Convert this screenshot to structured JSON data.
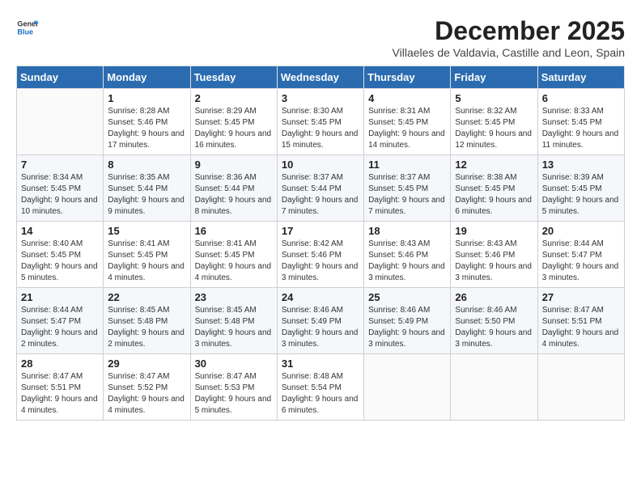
{
  "logo": {
    "general": "General",
    "blue": "Blue"
  },
  "title": "December 2025",
  "subtitle": "Villaeles de Valdavia, Castille and Leon, Spain",
  "header_days": [
    "Sunday",
    "Monday",
    "Tuesday",
    "Wednesday",
    "Thursday",
    "Friday",
    "Saturday"
  ],
  "weeks": [
    [
      {
        "day": "",
        "sunrise": "",
        "sunset": "",
        "daylight": ""
      },
      {
        "day": "1",
        "sunrise": "Sunrise: 8:28 AM",
        "sunset": "Sunset: 5:46 PM",
        "daylight": "Daylight: 9 hours and 17 minutes."
      },
      {
        "day": "2",
        "sunrise": "Sunrise: 8:29 AM",
        "sunset": "Sunset: 5:45 PM",
        "daylight": "Daylight: 9 hours and 16 minutes."
      },
      {
        "day": "3",
        "sunrise": "Sunrise: 8:30 AM",
        "sunset": "Sunset: 5:45 PM",
        "daylight": "Daylight: 9 hours and 15 minutes."
      },
      {
        "day": "4",
        "sunrise": "Sunrise: 8:31 AM",
        "sunset": "Sunset: 5:45 PM",
        "daylight": "Daylight: 9 hours and 14 minutes."
      },
      {
        "day": "5",
        "sunrise": "Sunrise: 8:32 AM",
        "sunset": "Sunset: 5:45 PM",
        "daylight": "Daylight: 9 hours and 12 minutes."
      },
      {
        "day": "6",
        "sunrise": "Sunrise: 8:33 AM",
        "sunset": "Sunset: 5:45 PM",
        "daylight": "Daylight: 9 hours and 11 minutes."
      }
    ],
    [
      {
        "day": "7",
        "sunrise": "Sunrise: 8:34 AM",
        "sunset": "Sunset: 5:45 PM",
        "daylight": "Daylight: 9 hours and 10 minutes."
      },
      {
        "day": "8",
        "sunrise": "Sunrise: 8:35 AM",
        "sunset": "Sunset: 5:44 PM",
        "daylight": "Daylight: 9 hours and 9 minutes."
      },
      {
        "day": "9",
        "sunrise": "Sunrise: 8:36 AM",
        "sunset": "Sunset: 5:44 PM",
        "daylight": "Daylight: 9 hours and 8 minutes."
      },
      {
        "day": "10",
        "sunrise": "Sunrise: 8:37 AM",
        "sunset": "Sunset: 5:44 PM",
        "daylight": "Daylight: 9 hours and 7 minutes."
      },
      {
        "day": "11",
        "sunrise": "Sunrise: 8:37 AM",
        "sunset": "Sunset: 5:45 PM",
        "daylight": "Daylight: 9 hours and 7 minutes."
      },
      {
        "day": "12",
        "sunrise": "Sunrise: 8:38 AM",
        "sunset": "Sunset: 5:45 PM",
        "daylight": "Daylight: 9 hours and 6 minutes."
      },
      {
        "day": "13",
        "sunrise": "Sunrise: 8:39 AM",
        "sunset": "Sunset: 5:45 PM",
        "daylight": "Daylight: 9 hours and 5 minutes."
      }
    ],
    [
      {
        "day": "14",
        "sunrise": "Sunrise: 8:40 AM",
        "sunset": "Sunset: 5:45 PM",
        "daylight": "Daylight: 9 hours and 5 minutes."
      },
      {
        "day": "15",
        "sunrise": "Sunrise: 8:41 AM",
        "sunset": "Sunset: 5:45 PM",
        "daylight": "Daylight: 9 hours and 4 minutes."
      },
      {
        "day": "16",
        "sunrise": "Sunrise: 8:41 AM",
        "sunset": "Sunset: 5:45 PM",
        "daylight": "Daylight: 9 hours and 4 minutes."
      },
      {
        "day": "17",
        "sunrise": "Sunrise: 8:42 AM",
        "sunset": "Sunset: 5:46 PM",
        "daylight": "Daylight: 9 hours and 3 minutes."
      },
      {
        "day": "18",
        "sunrise": "Sunrise: 8:43 AM",
        "sunset": "Sunset: 5:46 PM",
        "daylight": "Daylight: 9 hours and 3 minutes."
      },
      {
        "day": "19",
        "sunrise": "Sunrise: 8:43 AM",
        "sunset": "Sunset: 5:46 PM",
        "daylight": "Daylight: 9 hours and 3 minutes."
      },
      {
        "day": "20",
        "sunrise": "Sunrise: 8:44 AM",
        "sunset": "Sunset: 5:47 PM",
        "daylight": "Daylight: 9 hours and 3 minutes."
      }
    ],
    [
      {
        "day": "21",
        "sunrise": "Sunrise: 8:44 AM",
        "sunset": "Sunset: 5:47 PM",
        "daylight": "Daylight: 9 hours and 2 minutes."
      },
      {
        "day": "22",
        "sunrise": "Sunrise: 8:45 AM",
        "sunset": "Sunset: 5:48 PM",
        "daylight": "Daylight: 9 hours and 2 minutes."
      },
      {
        "day": "23",
        "sunrise": "Sunrise: 8:45 AM",
        "sunset": "Sunset: 5:48 PM",
        "daylight": "Daylight: 9 hours and 3 minutes."
      },
      {
        "day": "24",
        "sunrise": "Sunrise: 8:46 AM",
        "sunset": "Sunset: 5:49 PM",
        "daylight": "Daylight: 9 hours and 3 minutes."
      },
      {
        "day": "25",
        "sunrise": "Sunrise: 8:46 AM",
        "sunset": "Sunset: 5:49 PM",
        "daylight": "Daylight: 9 hours and 3 minutes."
      },
      {
        "day": "26",
        "sunrise": "Sunrise: 8:46 AM",
        "sunset": "Sunset: 5:50 PM",
        "daylight": "Daylight: 9 hours and 3 minutes."
      },
      {
        "day": "27",
        "sunrise": "Sunrise: 8:47 AM",
        "sunset": "Sunset: 5:51 PM",
        "daylight": "Daylight: 9 hours and 4 minutes."
      }
    ],
    [
      {
        "day": "28",
        "sunrise": "Sunrise: 8:47 AM",
        "sunset": "Sunset: 5:51 PM",
        "daylight": "Daylight: 9 hours and 4 minutes."
      },
      {
        "day": "29",
        "sunrise": "Sunrise: 8:47 AM",
        "sunset": "Sunset: 5:52 PM",
        "daylight": "Daylight: 9 hours and 4 minutes."
      },
      {
        "day": "30",
        "sunrise": "Sunrise: 8:47 AM",
        "sunset": "Sunset: 5:53 PM",
        "daylight": "Daylight: 9 hours and 5 minutes."
      },
      {
        "day": "31",
        "sunrise": "Sunrise: 8:48 AM",
        "sunset": "Sunset: 5:54 PM",
        "daylight": "Daylight: 9 hours and 6 minutes."
      },
      {
        "day": "",
        "sunrise": "",
        "sunset": "",
        "daylight": ""
      },
      {
        "day": "",
        "sunrise": "",
        "sunset": "",
        "daylight": ""
      },
      {
        "day": "",
        "sunrise": "",
        "sunset": "",
        "daylight": ""
      }
    ]
  ]
}
